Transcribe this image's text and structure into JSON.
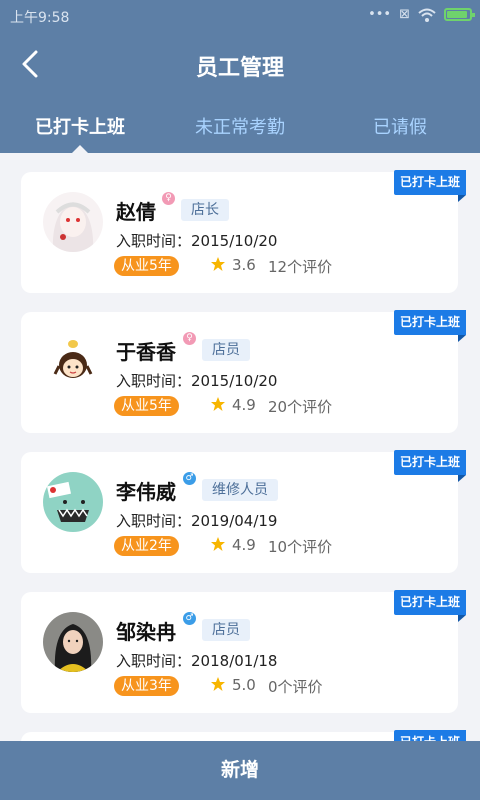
{
  "status_bar": {
    "time": "上午9:58",
    "icons": [
      "more-icon",
      "sim-icon",
      "wifi-icon",
      "battery-icon"
    ]
  },
  "header": {
    "title": "员工管理",
    "back_icon": "chevron-left-icon"
  },
  "tabs": [
    {
      "label": "已打卡上班",
      "active": true
    },
    {
      "label": "未正常考勤",
      "active": false
    },
    {
      "label": "已请假",
      "active": false
    }
  ],
  "hire_label": "入职时间：",
  "employees": [
    {
      "name": "赵倩",
      "gender": "female",
      "role": "店长",
      "hire_date": "2015/10/20",
      "experience": "从业5年",
      "rating": "3.6",
      "reviews": "12个评价",
      "badge": "已打卡上班",
      "avatar": "anime-girl-avatar"
    },
    {
      "name": "于香香",
      "gender": "female",
      "role": "店员",
      "hire_date": "2015/10/20",
      "experience": "从业5年",
      "rating": "4.9",
      "reviews": "20个评价",
      "badge": "已打卡上班",
      "avatar": "cartoon-girl-avatar"
    },
    {
      "name": "李伟威",
      "gender": "male",
      "role": "维修人员",
      "hire_date": "2019/04/19",
      "experience": "从业2年",
      "rating": "4.9",
      "reviews": "10个评价",
      "badge": "已打卡上班",
      "avatar": "green-monster-avatar"
    },
    {
      "name": "邹染冉",
      "gender": "male",
      "role": "店员",
      "hire_date": "2018/01/18",
      "experience": "从业3年",
      "rating": "5.0",
      "reviews": "0个评价",
      "badge": "已打卡上班",
      "avatar": "woman-photo-avatar"
    }
  ],
  "partial_card_badge": "已打卡上班",
  "footer": {
    "add_label": "新增"
  },
  "colors": {
    "header": "#5d7fa6",
    "badge": "#1c7be6",
    "experience": "#f7941d",
    "star": "#f7b500"
  }
}
